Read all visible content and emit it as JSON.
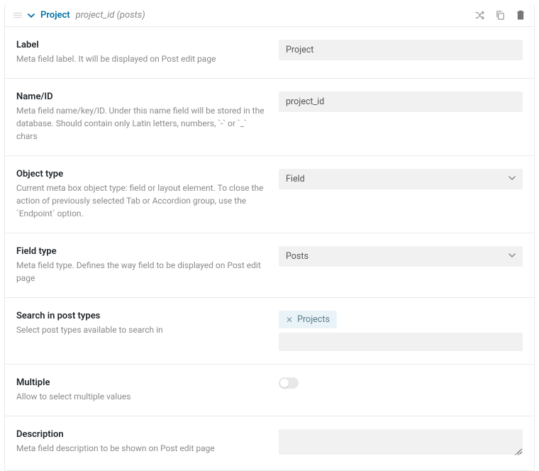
{
  "header": {
    "title": "Project",
    "meta": "project_id (posts)"
  },
  "rows": {
    "label": {
      "title": "Label",
      "desc": "Meta field label. It will be displayed on Post edit page",
      "value": "Project"
    },
    "name": {
      "title": "Name/ID",
      "desc": "Meta field name/key/ID. Under this name field will be stored in the database. Should contain only Latin letters, numbers, `-` or `_` chars",
      "value": "project_id"
    },
    "objectType": {
      "title": "Object type",
      "desc": "Current meta box object type: field or layout element. To close the action of previously selected Tab or Accordion group, use the `Endpoint` option.",
      "value": "Field"
    },
    "fieldType": {
      "title": "Field type",
      "desc": "Meta field type. Defines the way field to be displayed on Post edit page",
      "value": "Posts"
    },
    "searchPostTypes": {
      "title": "Search in post types",
      "desc": "Select post types available to search in",
      "tag": "Projects"
    },
    "multiple": {
      "title": "Multiple",
      "desc": "Allow to select multiple values"
    },
    "description": {
      "title": "Description",
      "desc": "Meta field description to be shown on Post edit page"
    }
  }
}
